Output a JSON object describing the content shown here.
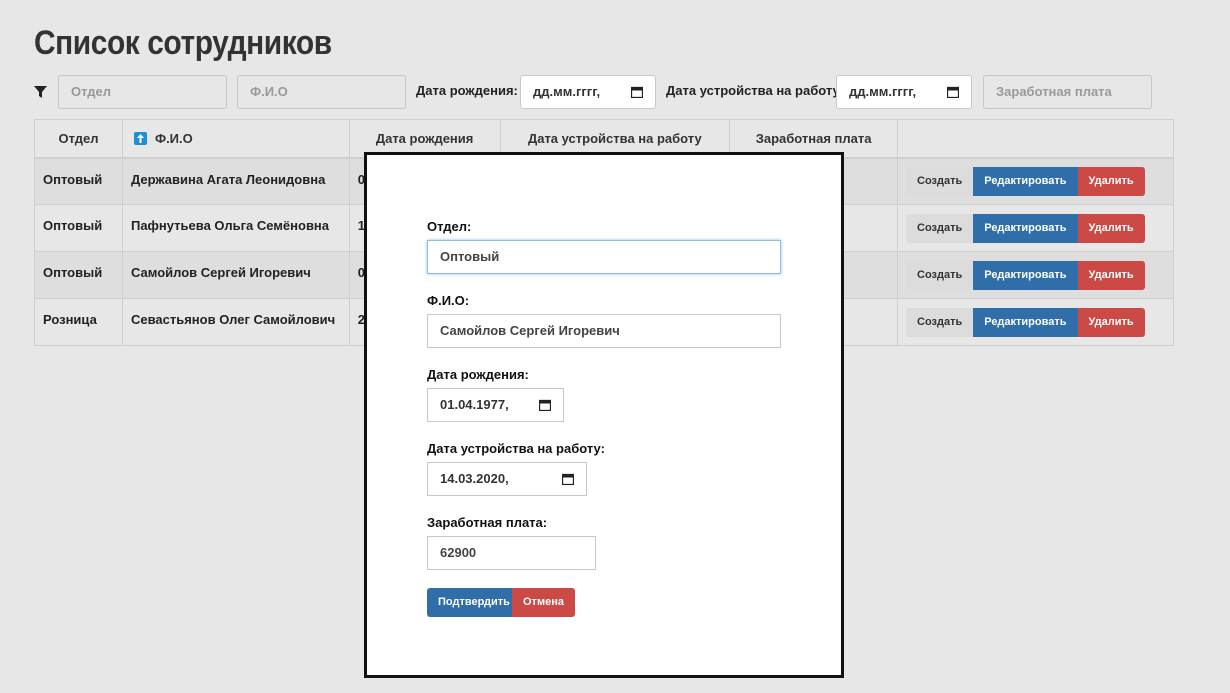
{
  "page": {
    "title": "Список сотрудников"
  },
  "filters": {
    "department_placeholder": "Отдел",
    "name_placeholder": "Ф.И.О",
    "birth_label": "Дата рождения:",
    "birth_value": "дд.мм.гггг,",
    "hire_label": "Дата устройства на работу:",
    "hire_value": "дд.мм.гггг,",
    "salary_placeholder": "Заработная плата",
    "filter_icon": "filter-icon",
    "calendar_icon": "calendar-icon"
  },
  "table": {
    "headers": [
      "Отдел",
      "Ф.И.О",
      "Дата рождения",
      "Дата устройства на работу",
      "Заработная плата",
      ""
    ],
    "sort_icon": "sort-up-icon",
    "rows": [
      {
        "department": "Оптовый",
        "name": "Державина Агата Леонидовна",
        "birth": "0"
      },
      {
        "department": "Оптовый",
        "name": "Пафнутьева Ольга Семёновна",
        "birth": "1"
      },
      {
        "department": "Оптовый",
        "name": "Самойлов Сергей Игоревич",
        "birth": "0"
      },
      {
        "department": "Розница",
        "name": "Севастьянов Олег Самойлович",
        "birth": "2"
      }
    ],
    "actions": {
      "create": "Создать",
      "edit": "Редактировать",
      "delete": "Удалить"
    }
  },
  "modal": {
    "department_label": "Отдел:",
    "department_value": "Оптовый",
    "name_label": "Ф.И.О:",
    "name_value": "Самойлов Сергей Игоревич",
    "birth_label": "Дата рождения:",
    "birth_value": "01.04.1977,",
    "hire_label": "Дата устройства на работу:",
    "hire_value": "14.03.2020,",
    "salary_label": "Заработная плата:",
    "salary_value": "62900",
    "confirm": "Подтвердить",
    "cancel": "Отмена"
  },
  "colors": {
    "primary": "#2f6ea8",
    "danger": "#cc4a45",
    "background": "#e7e7e7"
  }
}
